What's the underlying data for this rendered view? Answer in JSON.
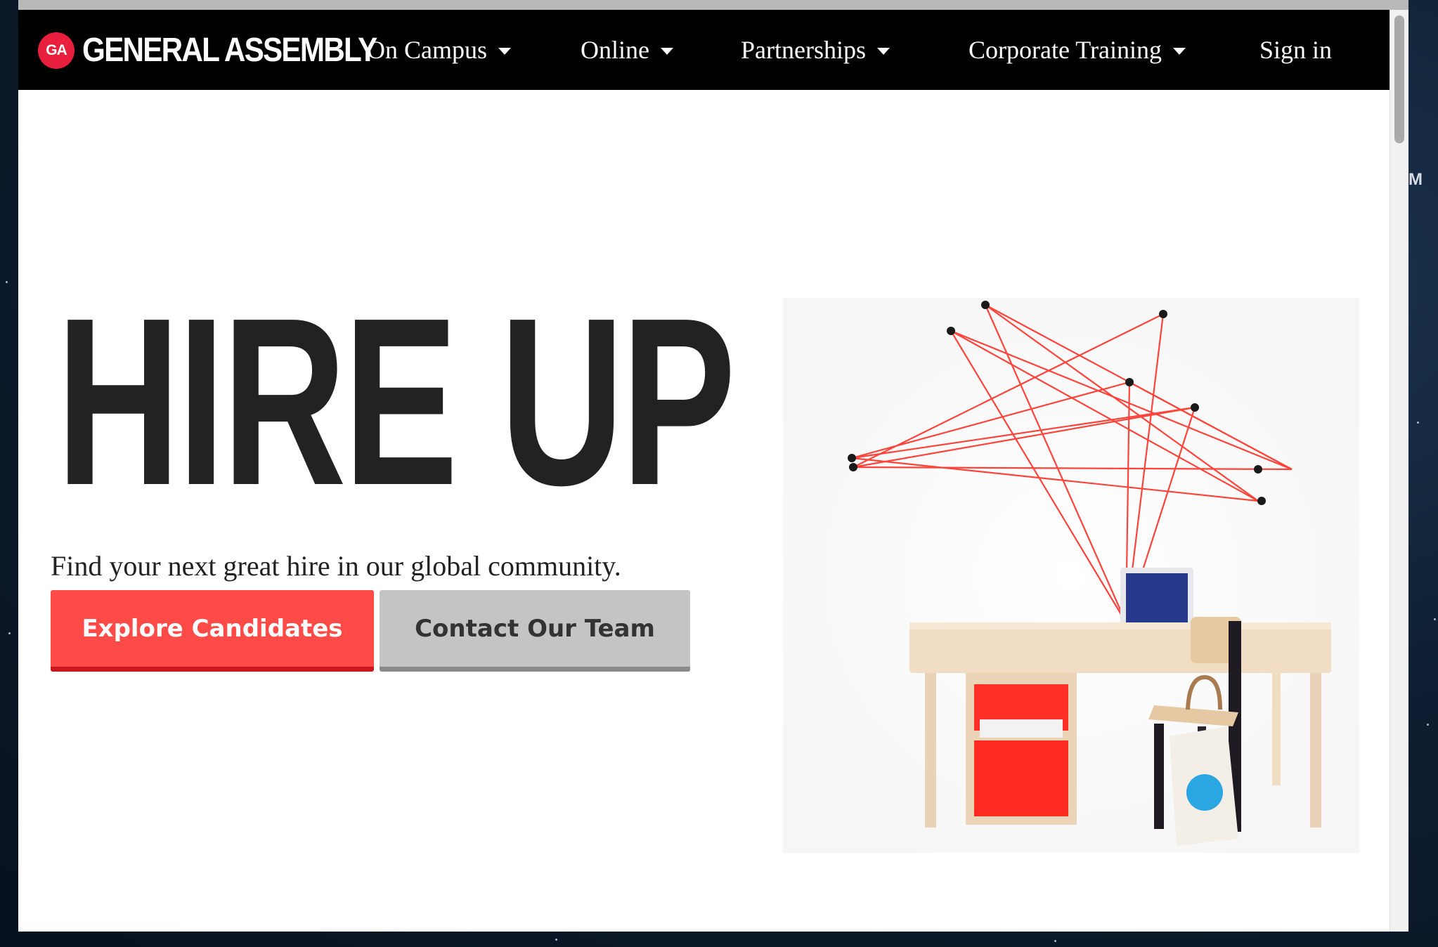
{
  "brand": {
    "badge": "GA",
    "name": "GENERAL ASSEMBLY"
  },
  "nav": {
    "items": [
      {
        "label": "On Campus",
        "dropdown": true
      },
      {
        "label": "Online",
        "dropdown": true
      },
      {
        "label": "Partnerships",
        "dropdown": true
      },
      {
        "label": "Corporate Training",
        "dropdown": true
      },
      {
        "label": "Sign in",
        "dropdown": false
      }
    ]
  },
  "hero": {
    "title": "HIRE UP",
    "subtitle": "Find your next great hire in our global community.",
    "primary_button": "Explore Candidates",
    "secondary_button": "Contact Our Team"
  },
  "desktop": {
    "side_letter": "M"
  },
  "colors": {
    "accent": "#ff4b48",
    "accent_shadow": "#c8171d",
    "logo_red": "#e8203d",
    "nav_bg": "#000000",
    "secondary_button": "#c4c4c4",
    "string_red": "#ff3b30"
  },
  "illustration": {
    "description_icon": "desk-and-string-art-illustration"
  }
}
